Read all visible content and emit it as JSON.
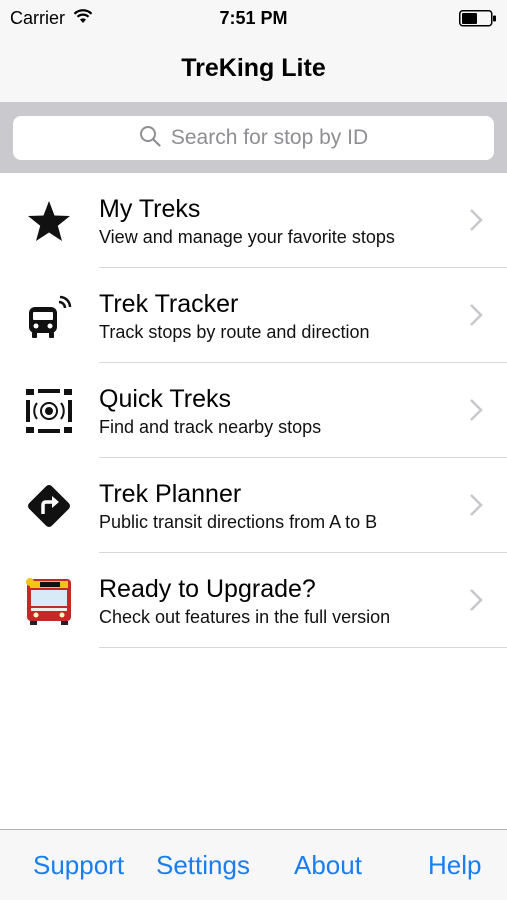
{
  "status": {
    "carrier": "Carrier",
    "time": "7:51 PM"
  },
  "nav": {
    "title": "TreKing Lite"
  },
  "search": {
    "placeholder": "Search for stop by ID"
  },
  "menu": [
    {
      "icon": "star-icon",
      "title": "My Treks",
      "subtitle": "View and manage your favorite stops"
    },
    {
      "icon": "bus-tracking-icon",
      "title": "Trek Tracker",
      "subtitle": "Track stops by route and direction"
    },
    {
      "icon": "nearby-radar-icon",
      "title": "Quick Treks",
      "subtitle": "Find and track nearby stops"
    },
    {
      "icon": "directions-sign-icon",
      "title": "Trek Planner",
      "subtitle": "Public transit directions from A to B"
    },
    {
      "icon": "upgrade-bus-icon",
      "title": "Ready to Upgrade?",
      "subtitle": "Check out features in the full version"
    }
  ],
  "tabs": {
    "support": "Support",
    "settings": "Settings",
    "about": "About",
    "help": "Help"
  },
  "colors": {
    "accent": "#1a7ef0",
    "search_bg": "#c9c9ce",
    "bar_bg": "#f7f7f7"
  }
}
